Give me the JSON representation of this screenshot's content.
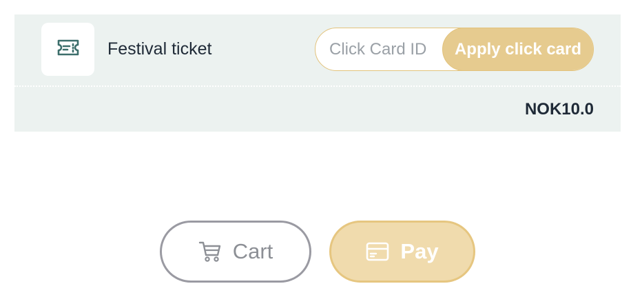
{
  "item": {
    "name": "Festival ticket",
    "icon": "ticket-icon",
    "total": "NOK10.0"
  },
  "coupon": {
    "placeholder": "Click Card ID",
    "value": "",
    "apply_label": "Apply click card"
  },
  "actions": {
    "cart_label": "Cart",
    "cart_icon": "cart-icon",
    "pay_label": "Pay",
    "pay_icon": "credit-card-icon"
  },
  "colors": {
    "card_background": "#ecf2f0",
    "accent_gold": "#e6cb8f",
    "pay_background": "#f0dbad",
    "text_dark": "#1f2a37",
    "icon_teal": "#3c6e6b"
  }
}
